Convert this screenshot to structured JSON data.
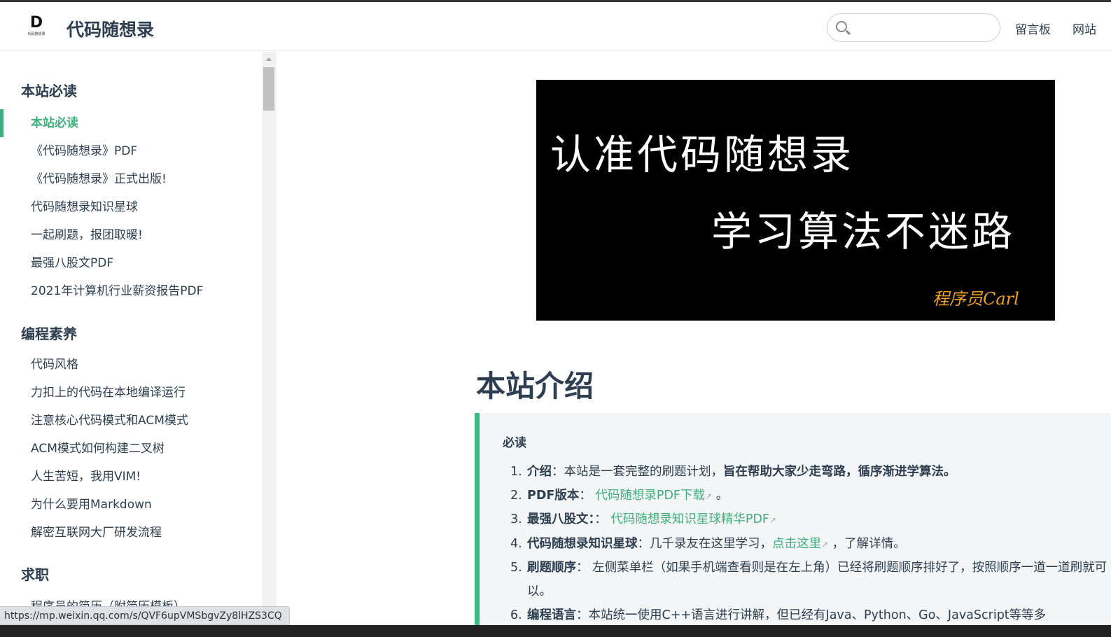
{
  "header": {
    "logo_letter": "D",
    "logo_text": "代码随想录",
    "title": "代码随想录",
    "search_placeholder": "",
    "nav": [
      "留言板",
      "网站"
    ]
  },
  "sidebar": {
    "groups": [
      {
        "title": "本站必读",
        "items": [
          "本站必读",
          "《代码随想录》PDF",
          "《代码随想录》正式出版!",
          "代码随想录知识星球",
          "一起刷题，报团取暖!",
          "最强八股文PDF",
          "2021年计算机行业薪资报告PDF"
        ]
      },
      {
        "title": "编程素养",
        "items": [
          "代码风格",
          "力扣上的代码在本地编译运行",
          "注意核心代码模式和ACM模式",
          "ACM模式如何构建二叉树",
          "人生苦短，我用VIM!",
          "为什么要用Markdown",
          "解密互联网大厂研发流程"
        ]
      },
      {
        "title": "求职",
        "items": [
          "程序员的简历（附简历模板）"
        ]
      }
    ],
    "active": "本站必读"
  },
  "banner": {
    "line1": "认准代码随想录",
    "line2": "学习算法不迷路",
    "signature": "程序员Carl"
  },
  "main": {
    "heading": "本站介绍",
    "tip_title": "必读",
    "list": [
      {
        "n": "1.",
        "label": "介绍",
        "sep": "：",
        "text": "本站是一套完整的刷题计划，",
        "bold": "旨在帮助大家少走弯路，循序渐进学算法。"
      },
      {
        "n": "2.",
        "label": "PDF版本",
        "sep": "： ",
        "link": "代码随想录PDF下载",
        "after": " 。"
      },
      {
        "n": "3.",
        "label": "最强八股文：",
        "sep": "： ",
        "link": "代码随想录知识星球精华PDF"
      },
      {
        "n": "4.",
        "label": "代码随想录知识星球",
        "sep": "：",
        "text": "几千录友在这里学习，",
        "link": "点击这里",
        "after": " ，了解详情。"
      },
      {
        "n": "5.",
        "label": "刷题顺序",
        "sep": "： ",
        "text": " 左侧菜单栏（如果手机端查看则是在左上角）已经将刷题顺序排好了，按照顺序一道一道刷就可以。"
      },
      {
        "n": "6.",
        "label": "编程语言",
        "sep": "：",
        "text": "本站统一使用C++语言进行讲解，但已经有Java、Python、Go、JavaScript等等多"
      }
    ]
  },
  "status_url": "https://mp.weixin.qq.com/s/QVF6upVMSbgvZy8lHZS3CQ",
  "colors": {
    "accent": "#3eaf7c",
    "text": "#2c3e50"
  }
}
